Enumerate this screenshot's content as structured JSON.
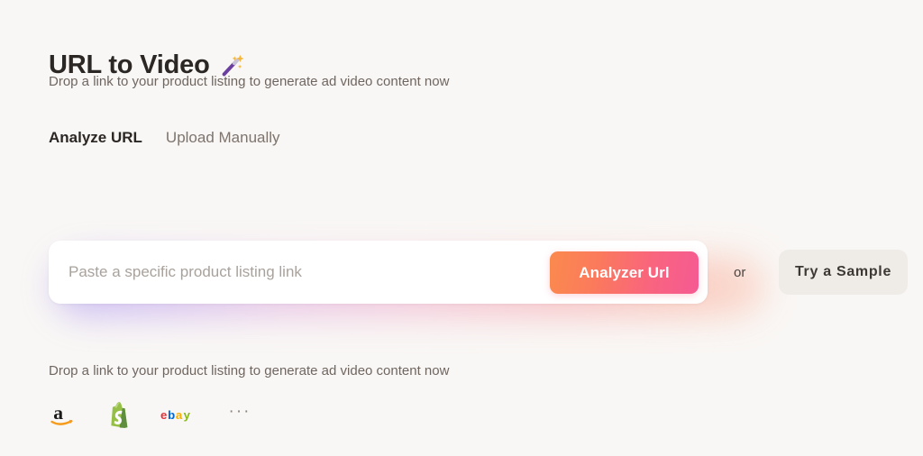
{
  "header": {
    "title": "URL to Video",
    "title_icon": "magic-wand-icon",
    "subtitle": "Drop a link to your product listing to generate ad video content now"
  },
  "tabs": [
    {
      "label": "Analyze URL",
      "active": true
    },
    {
      "label": "Upload Manually",
      "active": false
    }
  ],
  "input_row": {
    "placeholder": "Paste a specific product listing link",
    "value": "",
    "analyze_button": "Analyzer Url",
    "separator": "or",
    "sample_button": "Try a Sample"
  },
  "footer": {
    "note": "Drop a link to your product listing to generate ad video content now",
    "brands": [
      {
        "name": "amazon-logo",
        "label": "a"
      },
      {
        "name": "shopify-logo",
        "label": "S"
      },
      {
        "name": "ebay-logo",
        "label": "ebay"
      },
      {
        "name": "more-brands",
        "label": "···"
      }
    ]
  },
  "colors": {
    "background": "#F9F7F5",
    "card": "#FFFFFF",
    "accent_orange": "#FB8A4E",
    "accent_pink": "#F55A93",
    "text_primary": "#2B2724",
    "text_secondary": "#6F6660",
    "text_muted": "#A9A29C",
    "sample_button_bg": "#EFECE8",
    "amazon_orange": "#F59B1A",
    "shopify_green": "#95BF47",
    "ebay_red": "#E53238",
    "ebay_blue": "#0064D2",
    "ebay_yellow": "#F5AF02",
    "ebay_green": "#86B817"
  }
}
